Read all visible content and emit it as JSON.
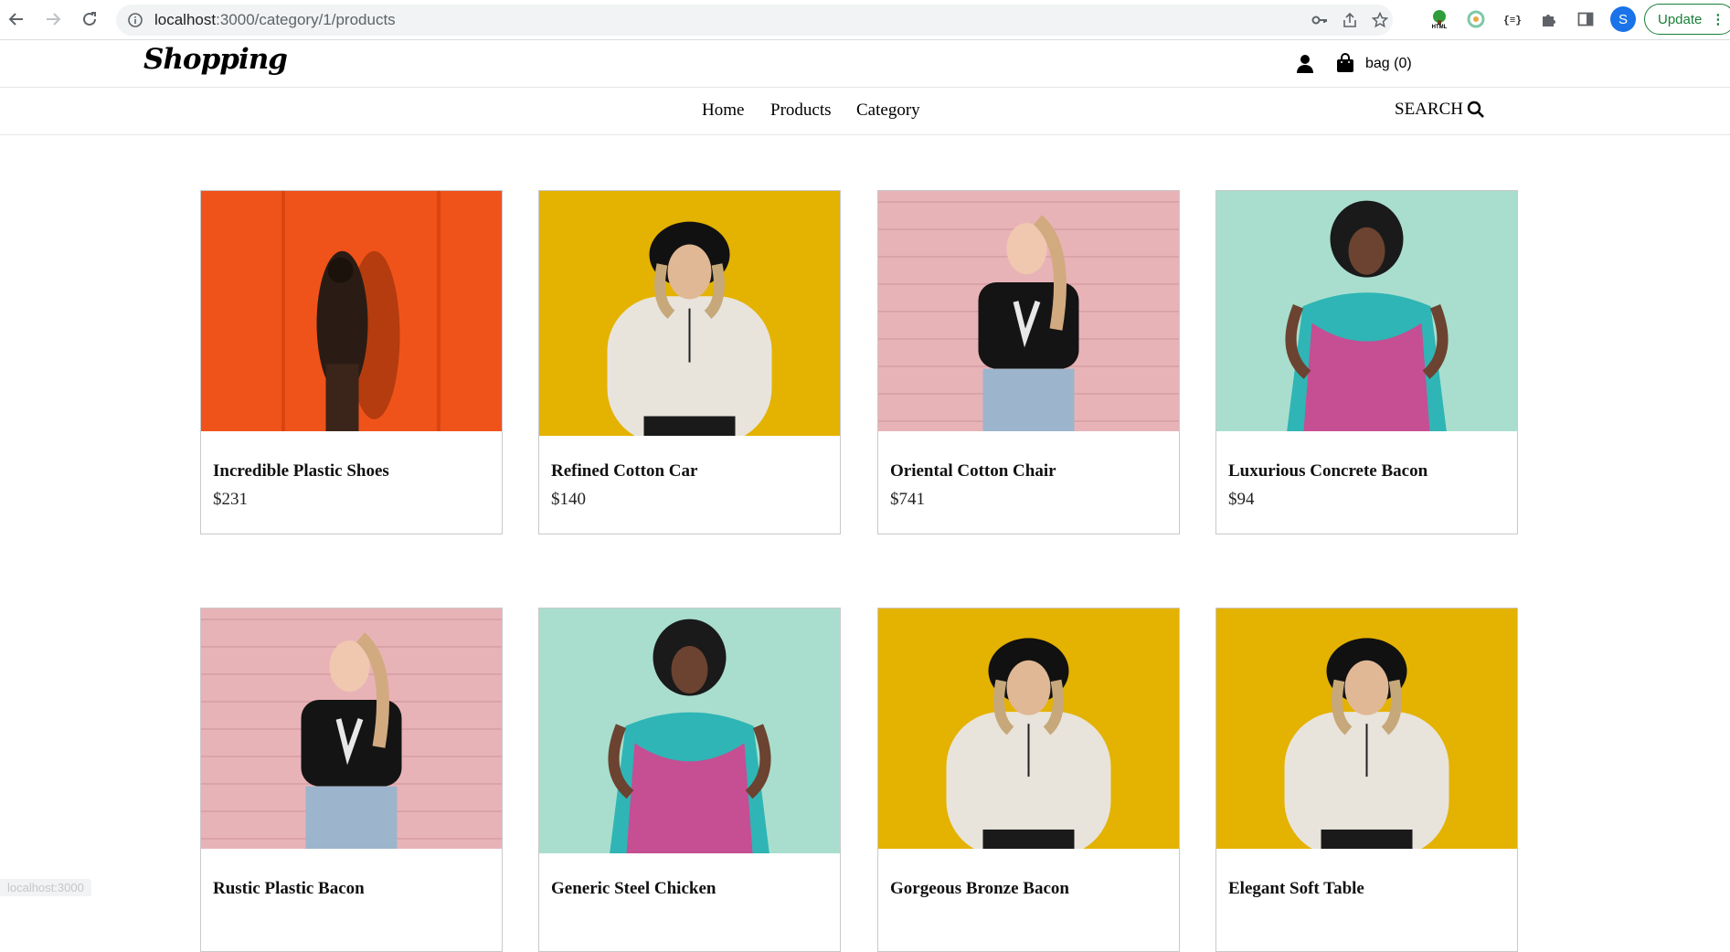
{
  "browser": {
    "url_host": "localhost",
    "url_rest": ":3000/category/1/products",
    "profile_initial": "S",
    "update_label": "Update",
    "status_url": "localhost:3000"
  },
  "site": {
    "logo": "Shopping",
    "bag_label": "bag (0)"
  },
  "nav": {
    "home": "Home",
    "products": "Products",
    "category": "Category",
    "search": "SEARCH"
  },
  "products": [
    {
      "name": "Incredible Plastic Shoes",
      "price": "$231",
      "photo": "orange"
    },
    {
      "name": "Refined Cotton Car",
      "price": "$140",
      "photo": "yellow"
    },
    {
      "name": "Oriental Cotton Chair",
      "price": "$741",
      "photo": "pink"
    },
    {
      "name": "Luxurious Concrete Bacon",
      "price": "$94",
      "photo": "mint"
    },
    {
      "name": "Rustic Plastic Bacon",
      "price": "",
      "photo": "pink"
    },
    {
      "name": "Generic Steel Chicken",
      "price": "",
      "photo": "mint"
    },
    {
      "name": "Gorgeous Bronze Bacon",
      "price": "",
      "photo": "yellow"
    },
    {
      "name": "Elegant Soft Table",
      "price": "",
      "photo": "yellow"
    }
  ],
  "colors": {
    "orange": "#f0531a",
    "yellow": "#e4b200",
    "pink": "#e8b3b7",
    "mint": "#a9dece"
  }
}
